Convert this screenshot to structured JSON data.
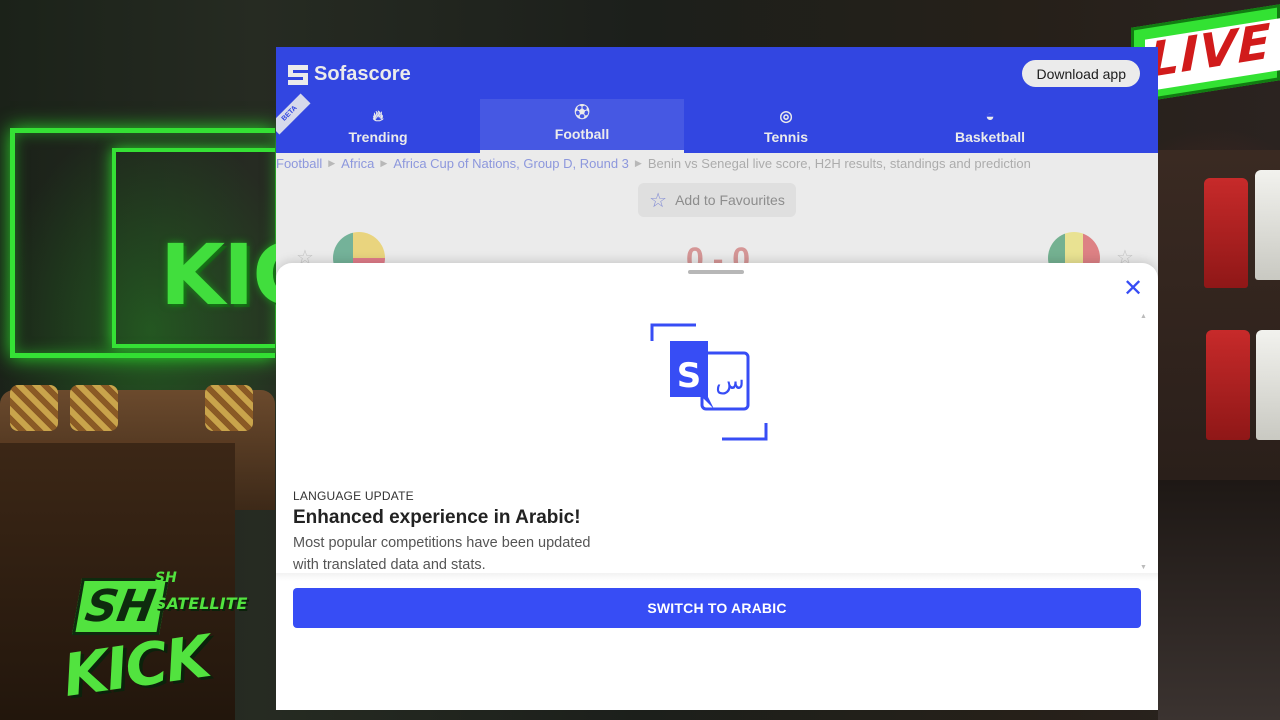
{
  "overlay": {
    "live_badge": "LIVE",
    "wall_sign": "KIC",
    "sh_logo": {
      "mark": "SH",
      "small": "SH",
      "satellite": "SATELLITE",
      "kick": "KICK"
    },
    "accent_green": "#35e135"
  },
  "app": {
    "name": "Sofascore",
    "brand_color": "#374df5",
    "download_label": "Download app",
    "beta_label": "BETA"
  },
  "tabs": [
    {
      "label": "Trending",
      "icon": "flame-icon",
      "active": false
    },
    {
      "label": "Football",
      "icon": "football-icon",
      "active": true
    },
    {
      "label": "Tennis",
      "icon": "tennis-icon",
      "active": false
    },
    {
      "label": "Basketball",
      "icon": "basketball-icon",
      "active": false
    }
  ],
  "breadcrumb": {
    "items": [
      "Football",
      "Africa",
      "Africa Cup of Nations, Group D, Round 3"
    ],
    "current": "Benin vs Senegal live score, H2H results, standings and prediction"
  },
  "match": {
    "favourites_label": "Add to Favourites",
    "score": "0 - 0",
    "home_flag": "benin-flag",
    "away_flag": "senegal-flag"
  },
  "modal": {
    "eyebrow": "LANGUAGE UPDATE",
    "title": "Enhanced experience in Arabic!",
    "body": "Most popular competitions have been updated with translated data and stats.",
    "illustration_letters": {
      "latin": "S",
      "arabic": "س"
    },
    "cta_label": "SWITCH TO ARABIC",
    "close_icon": "close-icon"
  }
}
